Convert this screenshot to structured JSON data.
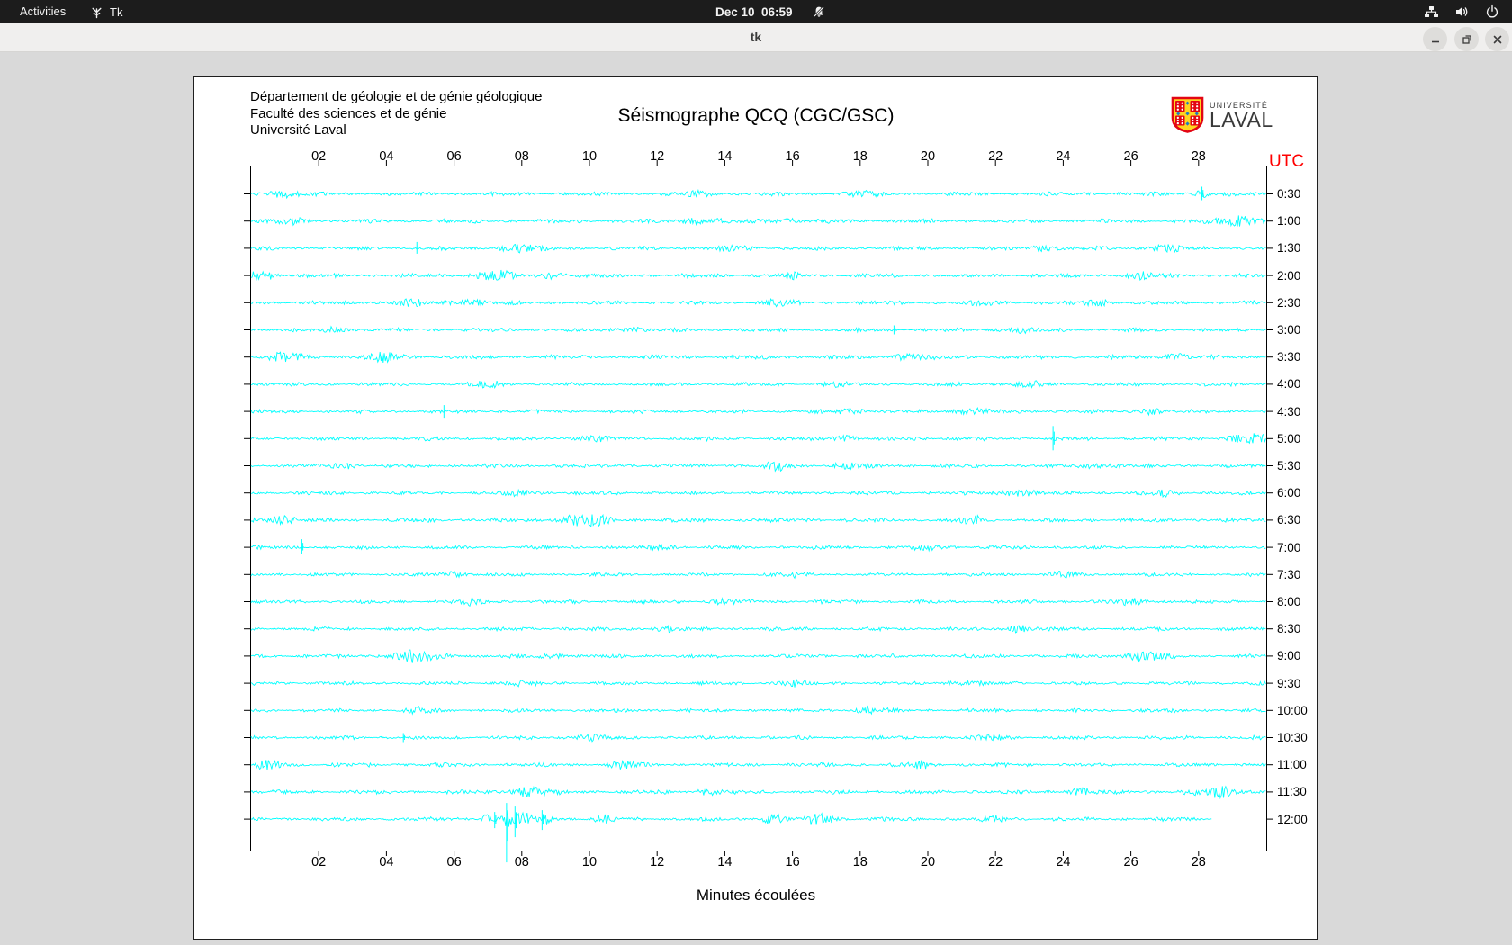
{
  "top_bar": {
    "activities_label": "Activities",
    "app_indicator_label": "Tk",
    "clock": "Dec 10  06:59",
    "icons": [
      "tk-icon",
      "bell-slash-icon",
      "wired-network-icon",
      "speaker-icon",
      "power-icon"
    ]
  },
  "title_bar": {
    "title": "tk"
  },
  "seismograph": {
    "header_lines": [
      "Département de géologie et de génie géologique",
      "Faculté des sciences et de génie",
      "Université Laval"
    ],
    "title": "Séismographe QCQ (CGC/GSC)",
    "utc_label": "UTC",
    "utc_color": "#ff0000",
    "xlabel": "Minutes écoulées",
    "trace_color": "#00ffff",
    "logo": {
      "line1": "UNIVERSITÉ",
      "line2": "LAVAL"
    },
    "x_ticks": [
      "02",
      "04",
      "06",
      "08",
      "10",
      "12",
      "14",
      "16",
      "18",
      "20",
      "22",
      "24",
      "26",
      "28"
    ],
    "x_minutes_range": [
      0,
      30
    ],
    "traces": [
      {
        "label": "0:30",
        "base": 2.2,
        "events": [
          {
            "m": 0.9,
            "a": 3,
            "w": 0.4
          },
          {
            "m": 13.3,
            "a": 2.5,
            "w": 0.3
          },
          {
            "m": 18,
            "a": 2.5,
            "w": 0.25
          },
          {
            "m": 28.1,
            "a": 4,
            "w": 0.15
          }
        ],
        "spikes": [
          {
            "m": 28.1,
            "up": 8,
            "down": 7
          }
        ]
      },
      {
        "label": "1:00",
        "base": 2.3,
        "events": [
          {
            "m": 1.2,
            "a": 3,
            "w": 0.3
          },
          {
            "m": 13.2,
            "a": 3,
            "w": 0.35
          },
          {
            "m": 15.7,
            "a": 2.5,
            "w": 0.3
          },
          {
            "m": 29.3,
            "a": 5,
            "w": 0.5
          }
        ]
      },
      {
        "label": "1:30",
        "base": 2.2,
        "events": [
          {
            "m": 7.9,
            "a": 3.5,
            "w": 0.4
          },
          {
            "m": 14.3,
            "a": 2.5,
            "w": 0.3
          },
          {
            "m": 23.5,
            "a": 3,
            "w": 0.25
          },
          {
            "m": 27,
            "a": 3.5,
            "w": 0.3
          }
        ],
        "spikes": [
          {
            "m": 4.9,
            "up": 7,
            "down": 6
          }
        ]
      },
      {
        "label": "2:00",
        "base": 2.3,
        "events": [
          {
            "m": 0.3,
            "a": 5,
            "w": 0.3
          },
          {
            "m": 7.2,
            "a": 4.5,
            "w": 0.45
          },
          {
            "m": 8.9,
            "a": 3.5,
            "w": 0.3
          },
          {
            "m": 16,
            "a": 3,
            "w": 0.2
          },
          {
            "m": 26.3,
            "a": 3.5,
            "w": 0.3
          }
        ]
      },
      {
        "label": "2:30",
        "base": 2.2,
        "events": [
          {
            "m": 4.7,
            "a": 3,
            "w": 0.3
          },
          {
            "m": 6.4,
            "a": 3.5,
            "w": 0.3
          },
          {
            "m": 15.5,
            "a": 3,
            "w": 0.3
          },
          {
            "m": 21.6,
            "a": 3,
            "w": 0.25
          },
          {
            "m": 25,
            "a": 3,
            "w": 0.3
          }
        ]
      },
      {
        "label": "3:00",
        "base": 2.1,
        "events": [
          {
            "m": 2.5,
            "a": 2.5,
            "w": 0.3
          },
          {
            "m": 11.2,
            "a": 3,
            "w": 0.25
          },
          {
            "m": 22.6,
            "a": 3,
            "w": 0.3
          }
        ],
        "spikes": [
          {
            "m": 19,
            "up": 5,
            "down": 5
          }
        ]
      },
      {
        "label": "3:30",
        "base": 2.3,
        "events": [
          {
            "m": 1,
            "a": 4,
            "w": 0.35
          },
          {
            "m": 3.9,
            "a": 4,
            "w": 0.4
          },
          {
            "m": 19.4,
            "a": 3.5,
            "w": 0.3
          },
          {
            "m": 27.3,
            "a": 3.5,
            "w": 0.25
          }
        ]
      },
      {
        "label": "4:00",
        "base": 2.1,
        "events": [
          {
            "m": 7,
            "a": 3,
            "w": 0.3
          },
          {
            "m": 17.2,
            "a": 2.5,
            "w": 0.25
          },
          {
            "m": 23,
            "a": 3,
            "w": 0.3
          }
        ]
      },
      {
        "label": "4:30",
        "base": 2.1,
        "events": [
          {
            "m": 17.8,
            "a": 3,
            "w": 0.3
          },
          {
            "m": 21.3,
            "a": 3.5,
            "w": 0.3
          },
          {
            "m": 26.6,
            "a": 3.5,
            "w": 0.25
          }
        ],
        "spikes": [
          {
            "m": 5.7,
            "up": 7,
            "down": 7
          }
        ]
      },
      {
        "label": "5:00",
        "base": 2.2,
        "events": [
          {
            "m": 10,
            "a": 2.5,
            "w": 0.3
          },
          {
            "m": 17.5,
            "a": 3,
            "w": 0.3
          },
          {
            "m": 29.5,
            "a": 4.5,
            "w": 0.4
          }
        ],
        "spikes": [
          {
            "m": 23.7,
            "up": 14,
            "down": 13
          }
        ]
      },
      {
        "label": "5:30",
        "base": 2.2,
        "events": [
          {
            "m": 2.7,
            "a": 3,
            "w": 0.3
          },
          {
            "m": 15.6,
            "a": 4,
            "w": 0.3
          },
          {
            "m": 17.6,
            "a": 3.5,
            "w": 0.25
          },
          {
            "m": 25,
            "a": 2.5,
            "w": 0.3
          }
        ]
      },
      {
        "label": "6:00",
        "base": 2.1,
        "events": [
          {
            "m": 8,
            "a": 2.5,
            "w": 0.3
          },
          {
            "m": 22.6,
            "a": 4,
            "w": 0.35
          },
          {
            "m": 27,
            "a": 2.5,
            "w": 0.3
          }
        ]
      },
      {
        "label": "6:30",
        "base": 2.3,
        "events": [
          {
            "m": 0.8,
            "a": 5,
            "w": 0.3
          },
          {
            "m": 9.8,
            "a": 6,
            "w": 0.5
          },
          {
            "m": 21.3,
            "a": 4,
            "w": 0.25
          }
        ]
      },
      {
        "label": "7:00",
        "base": 2.1,
        "events": [
          {
            "m": 12,
            "a": 2.5,
            "w": 0.3
          },
          {
            "m": 20,
            "a": 2.5,
            "w": 0.3
          }
        ],
        "spikes": [
          {
            "m": 1.5,
            "up": 9,
            "down": 7
          }
        ]
      },
      {
        "label": "7:30",
        "base": 2.0,
        "events": [
          {
            "m": 6,
            "a": 2.5,
            "w": 0.3
          },
          {
            "m": 16,
            "a": 2.5,
            "w": 0.3
          },
          {
            "m": 24,
            "a": 2.5,
            "w": 0.25
          }
        ]
      },
      {
        "label": "8:00",
        "base": 2.1,
        "events": [
          {
            "m": 6.5,
            "a": 3,
            "w": 0.3
          },
          {
            "m": 14,
            "a": 2.5,
            "w": 0.25
          },
          {
            "m": 26,
            "a": 3,
            "w": 0.3
          }
        ]
      },
      {
        "label": "8:30",
        "base": 2.1,
        "events": [
          {
            "m": 12.2,
            "a": 3,
            "w": 0.3
          },
          {
            "m": 22.7,
            "a": 3.5,
            "w": 0.3
          }
        ]
      },
      {
        "label": "9:00",
        "base": 2.2,
        "events": [
          {
            "m": 4.8,
            "a": 6,
            "w": 0.5
          },
          {
            "m": 9,
            "a": 2.5,
            "w": 0.3
          },
          {
            "m": 26.4,
            "a": 4.5,
            "w": 0.4
          }
        ]
      },
      {
        "label": "9:30",
        "base": 2.0,
        "events": [
          {
            "m": 8,
            "a": 2.5,
            "w": 0.3
          },
          {
            "m": 16,
            "a": 3,
            "w": 0.25
          },
          {
            "m": 21,
            "a": 2.5,
            "w": 0.3
          }
        ]
      },
      {
        "label": "10:00",
        "base": 2.0,
        "events": [
          {
            "m": 5,
            "a": 2.5,
            "w": 0.3
          },
          {
            "m": 18.3,
            "a": 3,
            "w": 0.3
          }
        ]
      },
      {
        "label": "10:30",
        "base": 2.1,
        "events": [
          {
            "m": 10,
            "a": 3,
            "w": 0.3
          },
          {
            "m": 22,
            "a": 2.5,
            "w": 0.3
          }
        ],
        "spikes": [
          {
            "m": 4.5,
            "up": 5,
            "down": 5
          }
        ]
      },
      {
        "label": "11:00",
        "base": 2.2,
        "events": [
          {
            "m": 0.5,
            "a": 4,
            "w": 0.35
          },
          {
            "m": 11,
            "a": 3,
            "w": 0.3
          },
          {
            "m": 19.8,
            "a": 3,
            "w": 0.25
          }
        ]
      },
      {
        "label": "11:30",
        "base": 2.3,
        "events": [
          {
            "m": 8.2,
            "a": 4.5,
            "w": 0.4
          },
          {
            "m": 13.5,
            "a": 3,
            "w": 0.3
          },
          {
            "m": 24.5,
            "a": 3,
            "w": 0.3
          },
          {
            "m": 28.6,
            "a": 5,
            "w": 0.5
          }
        ]
      },
      {
        "label": "12:00",
        "base": 2.2,
        "end": 28.4,
        "events": [
          {
            "m": 7.0,
            "a": 6,
            "w": 0.15
          },
          {
            "m": 7.6,
            "a": 9,
            "w": 0.12
          },
          {
            "m": 8.1,
            "a": 7,
            "w": 0.2
          },
          {
            "m": 8.7,
            "a": 6,
            "w": 0.12
          },
          {
            "m": 10.5,
            "a": 4,
            "w": 0.2
          },
          {
            "m": 15.4,
            "a": 5,
            "w": 0.25
          },
          {
            "m": 16.8,
            "a": 6,
            "w": 0.3
          },
          {
            "m": 22,
            "a": 3,
            "w": 0.2
          }
        ],
        "spikes": [
          {
            "m": 7.2,
            "up": 8,
            "down": 10
          },
          {
            "m": 7.55,
            "up": 18,
            "down": 48
          },
          {
            "m": 7.8,
            "up": 14,
            "down": 20
          },
          {
            "m": 8.6,
            "up": 10,
            "down": 12
          }
        ]
      }
    ]
  }
}
